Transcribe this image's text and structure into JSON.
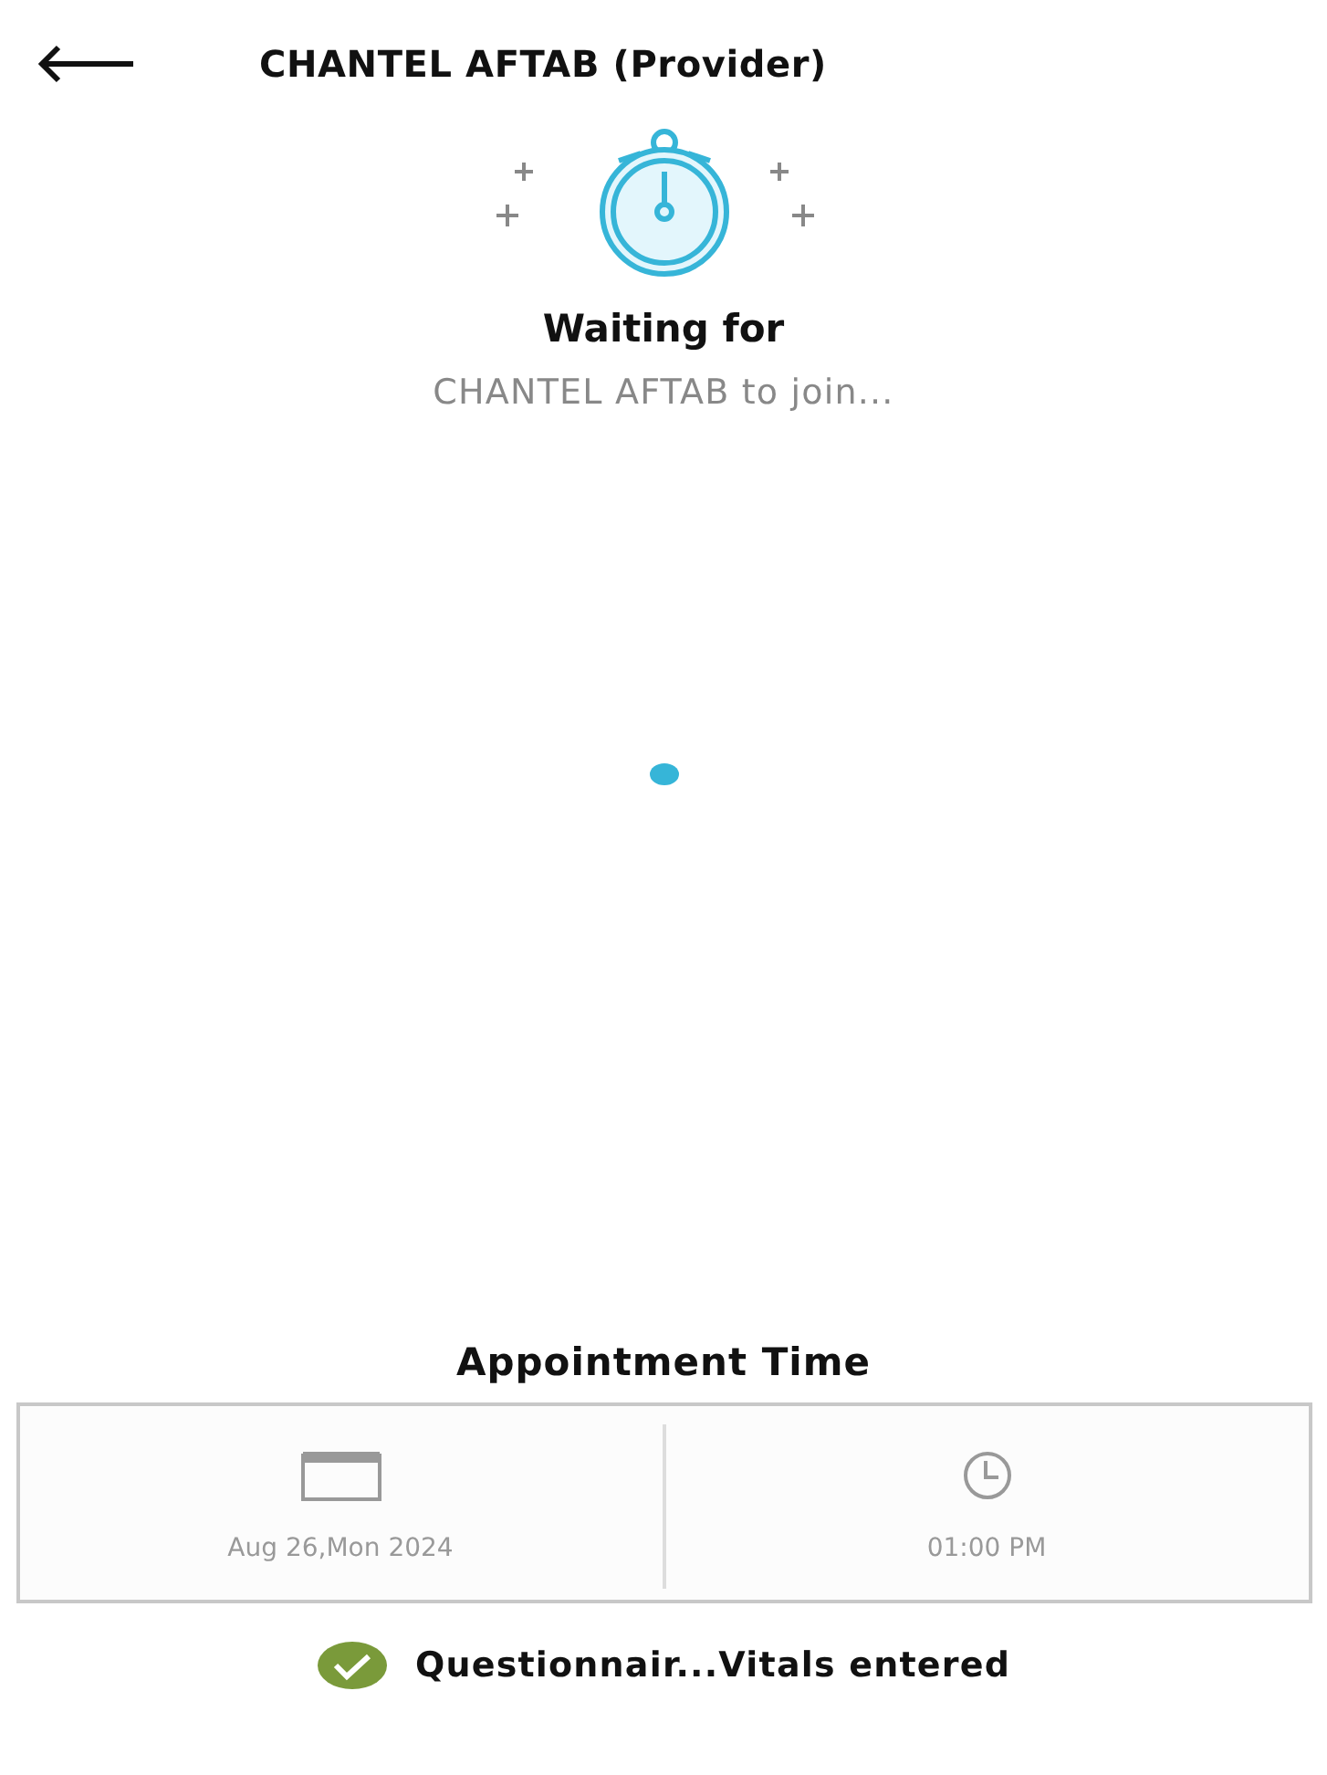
{
  "header": {
    "title": "CHANTEL AFTAB (Provider)"
  },
  "waiting": {
    "heading": "Waiting for",
    "message": "CHANTEL AFTAB to join..."
  },
  "appointment": {
    "heading": "Appointment Time",
    "date": "Aug 26,Mon 2024",
    "time": "01:00 PM"
  },
  "status": {
    "label": "Questionnair...Vitals entered",
    "checked": true
  }
}
